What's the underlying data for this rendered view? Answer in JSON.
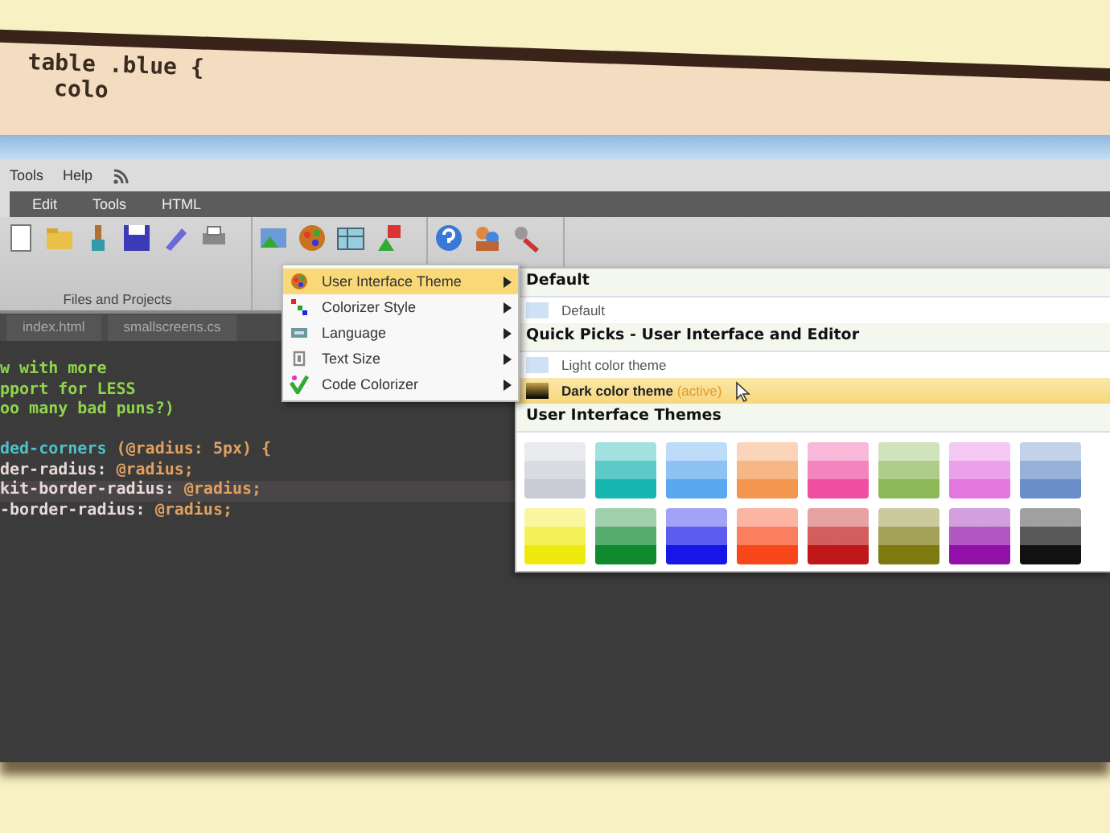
{
  "background_paper": {
    "code_lines": [
      "table .blue {",
      "  colo"
    ]
  },
  "menu_bar": {
    "items": [
      "Tools",
      "Help"
    ]
  },
  "ribbon_tabs": [
    "Edit",
    "Tools",
    "HTML"
  ],
  "toolbar": {
    "group_label": "Files and Projects"
  },
  "editor_tabs": [
    "index.html",
    "smallscreens.cs"
  ],
  "code_lines": [
    {
      "highlighted": false,
      "segments": [
        {
          "kind": "comment",
          "text": "w with more"
        }
      ]
    },
    {
      "highlighted": false,
      "segments": [
        {
          "kind": "comment",
          "text": "pport for LESS"
        }
      ]
    },
    {
      "highlighted": false,
      "segments": [
        {
          "kind": "comment",
          "text": "oo many bad puns?)"
        }
      ]
    },
    {
      "highlighted": false,
      "segments": [
        {
          "kind": "selector",
          "text": "ded-corners "
        },
        {
          "kind": "value",
          "text": "(@radius: 5px) {"
        }
      ]
    },
    {
      "highlighted": false,
      "segments": [
        {
          "kind": "property",
          "text": "der-radius: "
        },
        {
          "kind": "value",
          "text": "@radius;"
        }
      ]
    },
    {
      "highlighted": true,
      "segments": [
        {
          "kind": "property",
          "text": "kit-border-radius: "
        },
        {
          "kind": "value",
          "text": "@radius;"
        }
      ]
    },
    {
      "highlighted": false,
      "segments": [
        {
          "kind": "property",
          "text": "-border-radius: "
        },
        {
          "kind": "value",
          "text": "@radius;"
        }
      ]
    }
  ],
  "context_menu": {
    "items": [
      {
        "label": "User Interface Theme",
        "selected": true
      },
      {
        "label": "Colorizer Style",
        "selected": false
      },
      {
        "label": "Language",
        "selected": false
      },
      {
        "label": "Text Size",
        "selected": false
      },
      {
        "label": "Code Colorizer",
        "selected": false
      }
    ]
  },
  "submenu": {
    "sections": [
      {
        "title": "Default",
        "items": [
          {
            "label": "Default",
            "selected": false
          }
        ]
      },
      {
        "title": "Quick Picks - User Interface and Editor",
        "items": [
          {
            "label": "Light color theme",
            "selected": false
          },
          {
            "label": "Dark color theme",
            "note": "(active)",
            "selected": true
          }
        ]
      },
      {
        "title": "User Interface Themes",
        "swatches": [
          {
            "color": "#c9ccd6"
          },
          {
            "color": "#16b5b0"
          },
          {
            "color": "#5aa8ef"
          },
          {
            "color": "#f29650"
          },
          {
            "color": "#ee4fa0"
          },
          {
            "color": "#8db858"
          },
          {
            "color": "#e377e0"
          },
          {
            "color": "#6a8fc8"
          },
          {
            "color": "#eeea10"
          },
          {
            "color": "#0f8a2e"
          },
          {
            "color": "#1616e8"
          },
          {
            "color": "#f8471a"
          },
          {
            "color": "#c01818"
          },
          {
            "color": "#7d7a10"
          },
          {
            "color": "#9010a8"
          },
          {
            "color": "#111111"
          }
        ]
      }
    ]
  }
}
